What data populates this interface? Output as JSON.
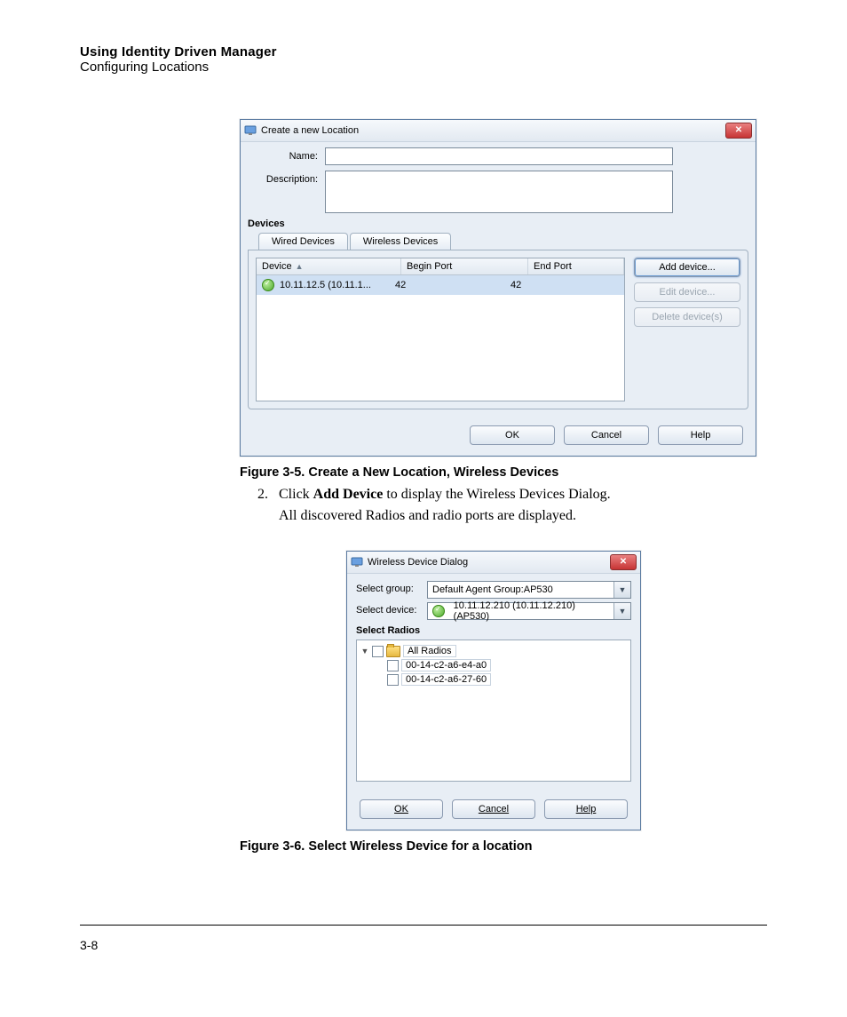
{
  "header": {
    "line1": "Using Identity Driven Manager",
    "line2": "Configuring Locations"
  },
  "dialog1": {
    "title": "Create a new Location",
    "labels": {
      "name": "Name:",
      "description": "Description:",
      "devices": "Devices"
    },
    "tabs": {
      "wired": "Wired Devices",
      "wireless": "Wireless Devices"
    },
    "columns": {
      "device": "Device",
      "begin": "Begin Port",
      "end": "End Port"
    },
    "rows": [
      {
        "device": "10.11.12.5 (10.11.1...",
        "begin": "42",
        "end": "42"
      }
    ],
    "side_buttons": {
      "add": "Add device...",
      "edit": "Edit device...",
      "delete": "Delete device(s)"
    },
    "buttons": {
      "ok": "OK",
      "cancel": "Cancel",
      "help": "Help"
    }
  },
  "caption1": "Figure 3-5. Create a New Location, Wireless Devices",
  "step": {
    "num": "2.",
    "prefix": "Click ",
    "bold": "Add Device",
    "suffix": " to display the Wireless Devices Dialog."
  },
  "step_line2": "All discovered Radios and radio ports are displayed.",
  "dialog2": {
    "title": "Wireless Device Dialog",
    "labels": {
      "group": "Select group:",
      "device": "Select device:",
      "radios": "Select Radios"
    },
    "group_value": "Default Agent Group:AP530",
    "device_value": "10.11.12.210 (10.11.12.210) (AP530)",
    "tree": {
      "root": "All Radios",
      "children": [
        "00-14-c2-a6-e4-a0",
        "00-14-c2-a6-27-60"
      ]
    },
    "buttons": {
      "ok": "OK",
      "cancel": "Cancel",
      "help": "Help"
    }
  },
  "caption2": "Figure 3-6. Select Wireless Device for a location",
  "page_number": "3-8"
}
